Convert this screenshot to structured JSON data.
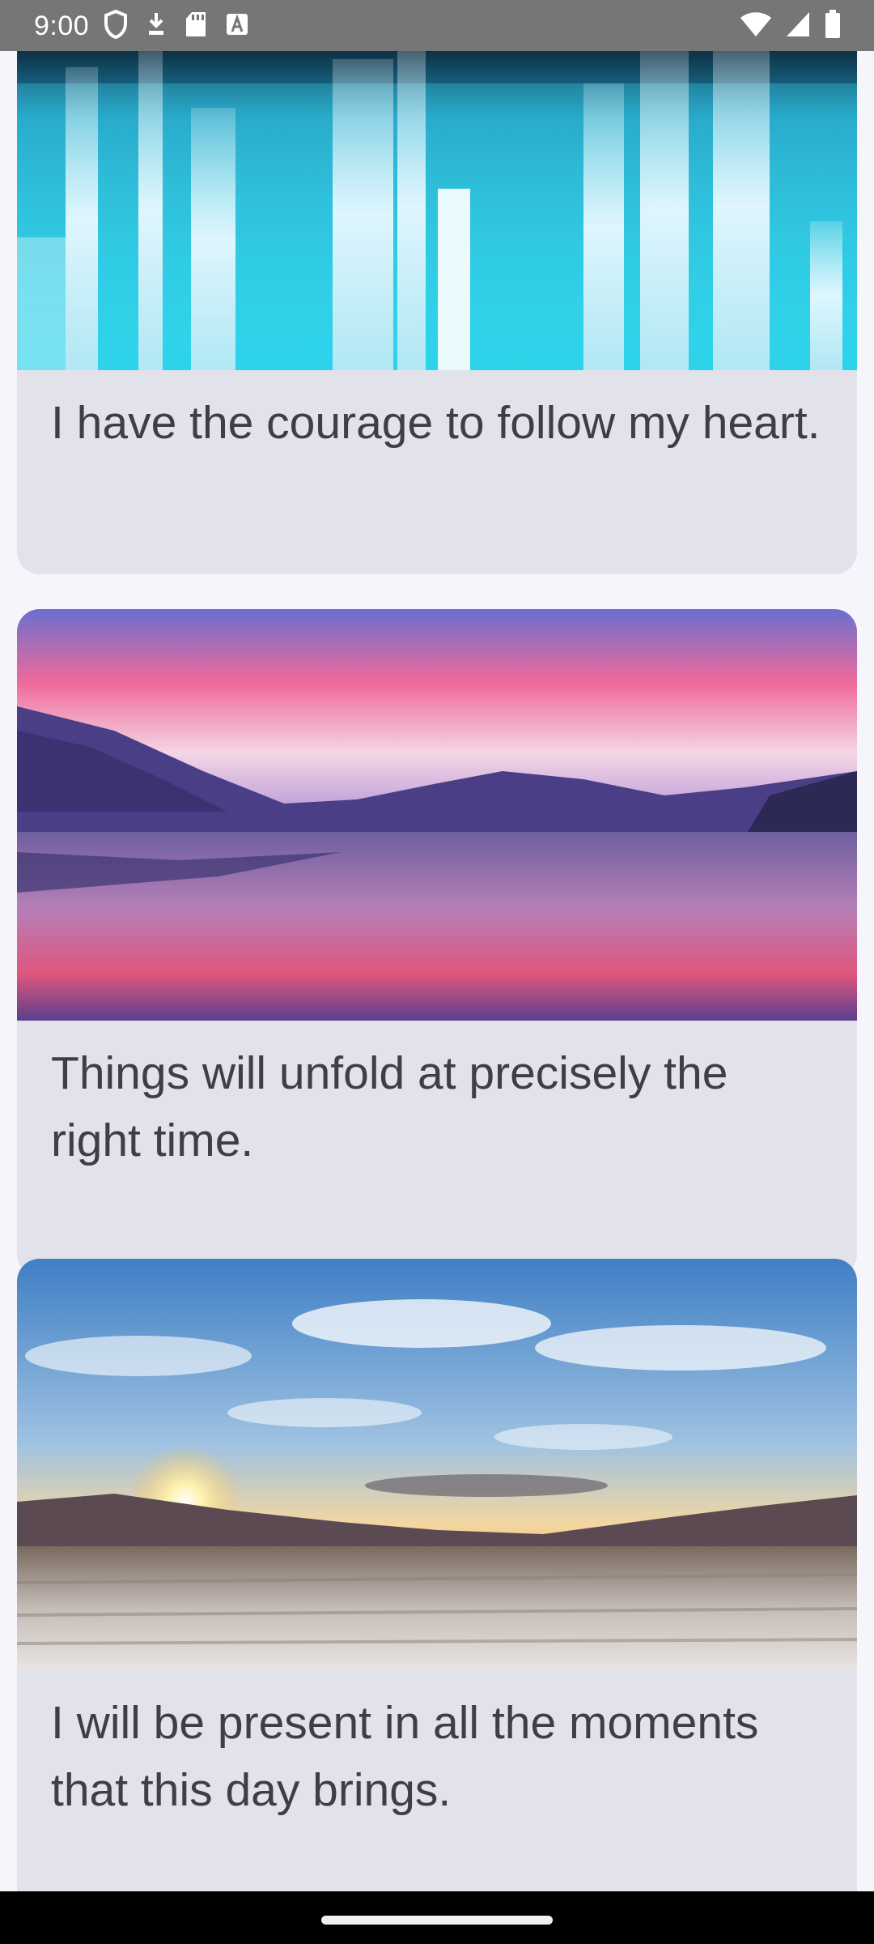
{
  "status_bar": {
    "time": "9:00",
    "left_icons": [
      "shield-icon",
      "download-icon",
      "sd-card-icon",
      "font-a-icon"
    ],
    "right_icons": [
      "wifi-icon",
      "cell-signal-icon",
      "battery-icon"
    ]
  },
  "cards": [
    {
      "image": "blue-crystal-light-streaks",
      "text": "I have the courage to follow my heart."
    },
    {
      "image": "pink-sky-lake-reflection",
      "text": "Things will unfold at precisely the right time."
    },
    {
      "image": "sunset-salt-flats-clouds",
      "text": "I will be present in all the moments that this day brings."
    }
  ],
  "colors": {
    "status_bar": "#767676",
    "background": "#f6f5fb",
    "card": "#e2e2ea",
    "text": "#3e3e48"
  }
}
